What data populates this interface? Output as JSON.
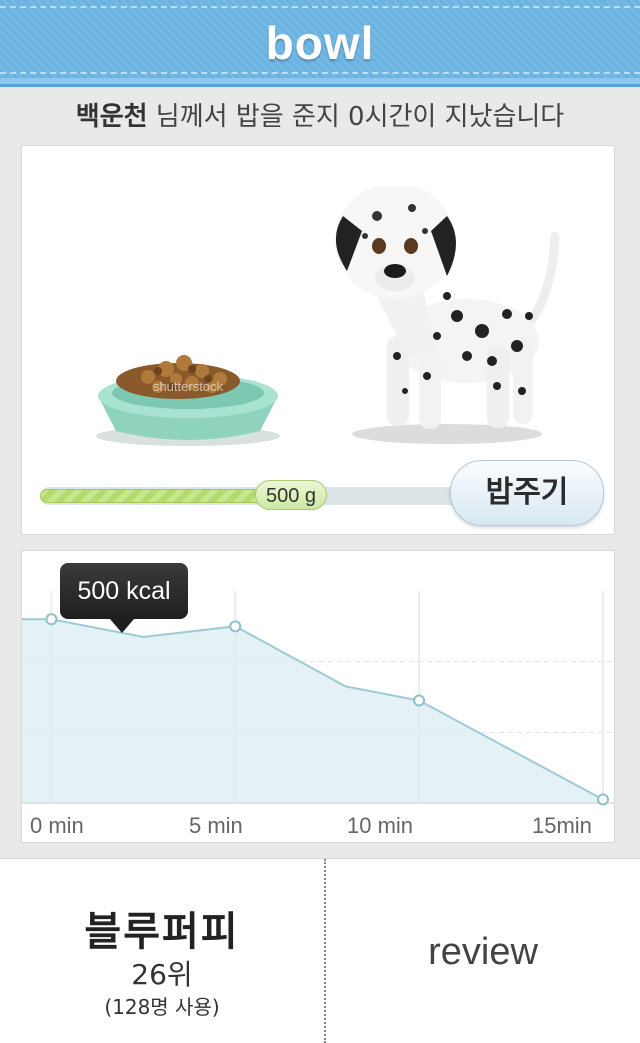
{
  "header": {
    "title": "bowl"
  },
  "banner": {
    "name": "백운천",
    "message": " 님께서 밥을 준지 0시간이 지났습니다"
  },
  "feed": {
    "amount_label": "500 g",
    "amount_fraction": 0.64,
    "feed_button_label": "밥주기",
    "watermark": "shutterstock"
  },
  "chart_data": {
    "type": "area",
    "x": [
      0,
      2.5,
      5,
      8,
      10,
      15
    ],
    "values": [
      520,
      470,
      500,
      330,
      290,
      10
    ],
    "ylim": [
      0,
      600
    ],
    "xlim": [
      -0.8,
      15.3
    ],
    "marked_points": [
      0,
      5,
      10,
      15
    ],
    "xticks": [
      "0  min",
      "5 min",
      "10 min",
      "15min"
    ],
    "tooltip": "500 kcal",
    "grid": true,
    "colors": {
      "line": "#9ccbd6",
      "fill": "#dcedf2",
      "point": "#ffffff"
    }
  },
  "bottom": {
    "name": "블루퍼피",
    "rank": "26위",
    "users": "(128명 사용)",
    "review_label": "review"
  }
}
